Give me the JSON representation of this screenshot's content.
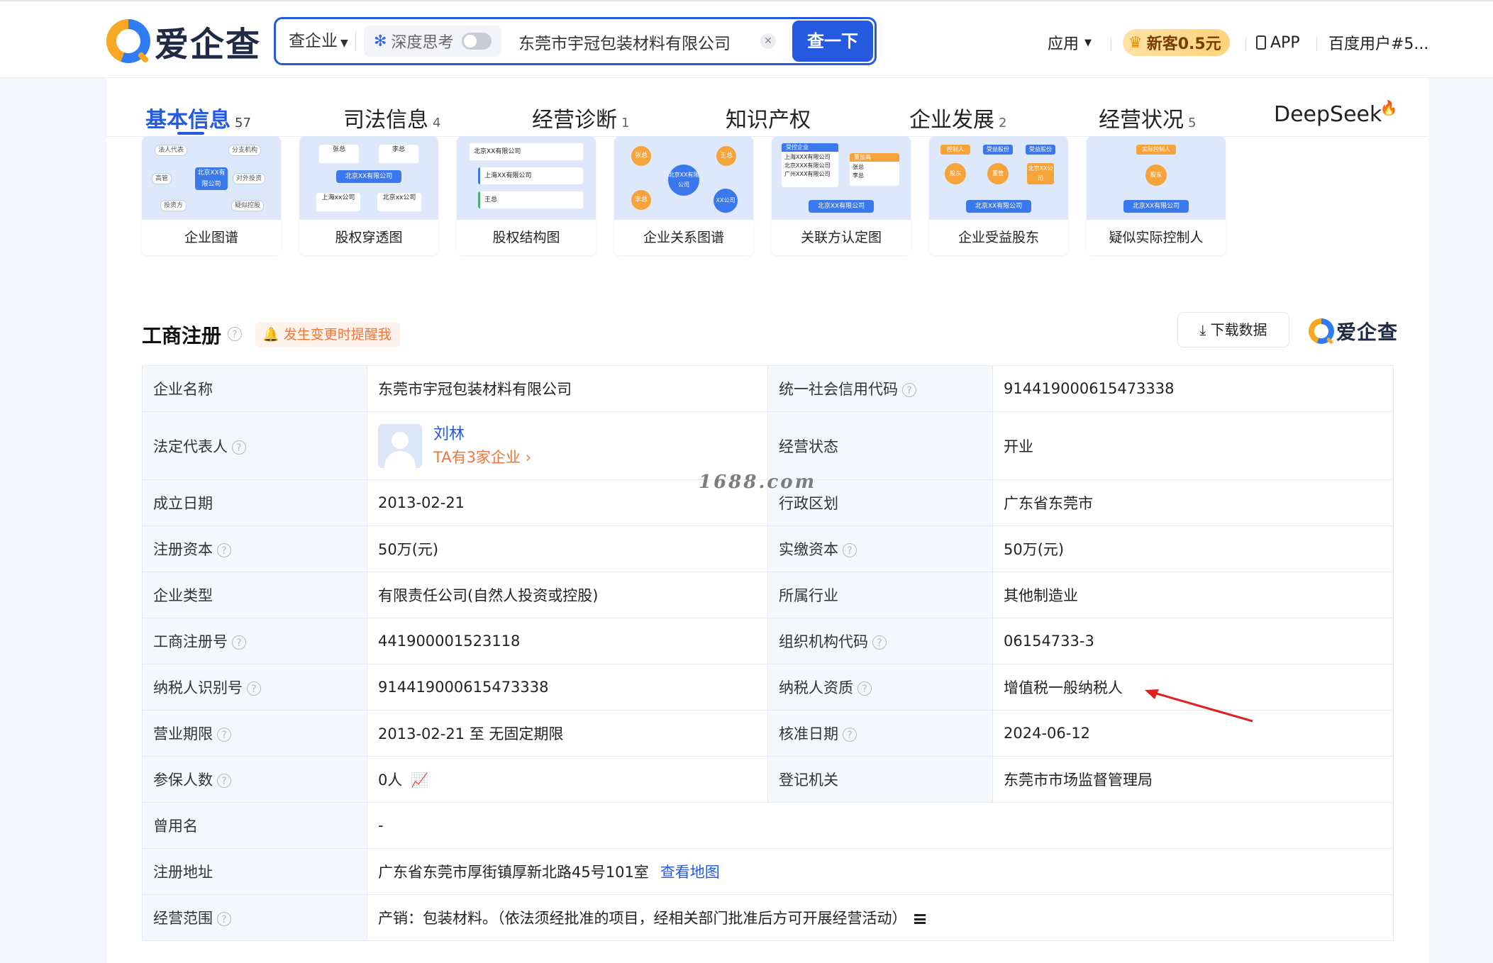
{
  "header": {
    "logo_text": "爱企查",
    "search": {
      "type_label": "查企业",
      "deep_think_label": "深度思考",
      "query": "东莞市宇冠包装材料有限公司",
      "button_label": "查一下"
    },
    "nav": {
      "apps_label": "应用",
      "vip_label": "新客0.5元",
      "app_label": "APP",
      "user_label": "百度用户#5..."
    }
  },
  "tabs": [
    {
      "label": "基本信息",
      "count": "57",
      "active": true
    },
    {
      "label": "司法信息",
      "count": "4"
    },
    {
      "label": "经营诊断",
      "count": "1"
    },
    {
      "label": "知识产权",
      "count": ""
    },
    {
      "label": "企业发展",
      "count": "2"
    },
    {
      "label": "经营状况",
      "count": "5"
    },
    {
      "label": "DeepSeek",
      "count": ""
    }
  ],
  "cards": [
    {
      "label": "企业图谱",
      "thumb": {
        "center": "北京XX有限公司",
        "nodes": [
          "法人代表",
          "分支机构",
          "高管",
          "对外投资",
          "投资方",
          "疑似控股"
        ]
      }
    },
    {
      "label": "股权穿透图",
      "thumb": {
        "center": "北京XX有限公司",
        "nodes": [
          "张总",
          "李总",
          "上海xx公司",
          "北京xx公司"
        ]
      }
    },
    {
      "label": "股权结构图",
      "thumb": {
        "nodes": [
          "北京XX有限公司",
          "上海XX有限公司",
          "王总"
        ]
      }
    },
    {
      "label": "企业关系图谱",
      "thumb": {
        "center": "北京XX有限公司",
        "nodes": [
          "张总",
          "王总",
          "李总",
          "XX公司"
        ]
      }
    },
    {
      "label": "关联方认定图",
      "thumb": {
        "nodes": [
          "受控企业",
          "上海XXX有限公司",
          "北京XXX有限公司",
          "广州XXX有限公司",
          "董监高",
          "张总",
          "李总",
          "北京XX有限公司"
        ]
      }
    },
    {
      "label": "企业受益股东",
      "thumb": {
        "nodes": [
          "控制人",
          "受益股份",
          "受益股份",
          "股东",
          "董管",
          "北京XX公司",
          "北京XX有限公司"
        ]
      }
    },
    {
      "label": "疑似实际控制人",
      "thumb": {
        "nodes": [
          "实际控制人",
          "股东",
          "北京XX有限公司"
        ]
      }
    }
  ],
  "section": {
    "title": "工商注册",
    "remind_label": "发生变更时提醒我",
    "download_label": "下载数据",
    "brand_label": "爱企查"
  },
  "info": {
    "labels": {
      "name": "企业名称",
      "credit_code": "统一社会信用代码",
      "legal_rep": "法定代表人",
      "status": "经营状态",
      "founded": "成立日期",
      "region": "行政区划",
      "capital": "注册资本",
      "paid_capital": "实缴资本",
      "type": "企业类型",
      "industry": "所属行业",
      "reg_no": "工商注册号",
      "org_code": "组织机构代码",
      "tax_id": "纳税人识别号",
      "tax_qual": "纳税人资质",
      "term": "营业期限",
      "approved": "核准日期",
      "insured": "参保人数",
      "authority": "登记机关",
      "former_name": "曾用名",
      "address": "注册地址",
      "scope": "经营范围"
    },
    "values": {
      "name": "东莞市宇冠包装材料有限公司",
      "credit_code": "914419000615473338",
      "legal_rep_name": "刘林",
      "legal_rep_sub": "TA有3家企业 ›",
      "status": "开业",
      "founded": "2013-02-21",
      "region": "广东省东莞市",
      "capital": "50万(元)",
      "paid_capital": "50万(元)",
      "type": "有限责任公司(自然人投资或控股)",
      "industry": "其他制造业",
      "reg_no": "441900001523118",
      "org_code": "06154733-3",
      "tax_id": "914419000615473338",
      "tax_qual": "增值税一般纳税人",
      "term": "2013-02-21 至 无固定期限",
      "approved": "2024-06-12",
      "insured": "0人",
      "authority": "东莞市市场监督管理局",
      "former_name": "-",
      "address": "广东省东莞市厚街镇厚新北路45号101室",
      "map_link": "查看地图",
      "scope": "产销：包装材料。（依法须经批准的项目，经相关部门批准后方可开展经营活动）"
    }
  },
  "watermark": "1688.com",
  "colors": {
    "accent": "#2459e0",
    "orange": "#f0763a",
    "arrow": "#e0201d"
  }
}
